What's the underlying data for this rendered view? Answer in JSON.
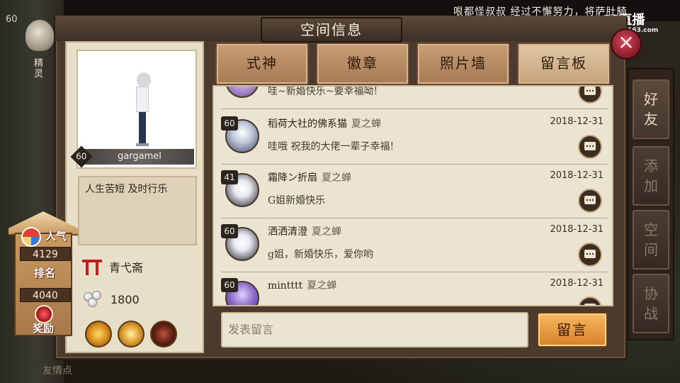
{
  "marquee": "哏都怪叔叔 经过不懈努力，将萨肚騎",
  "watermark": {
    "brand": "CC直播",
    "sub": "cc.163.com"
  },
  "background": {
    "level": "60",
    "side_label": "精灵",
    "bottom_text": "友情点"
  },
  "window": {
    "title": "空间信息",
    "close_symbol": "✕"
  },
  "profile": {
    "level": "60",
    "name": "gargamel",
    "motto": "人生苦短 及时行乐",
    "guild": "青弋斋",
    "coins": "1800"
  },
  "popularity": {
    "label_pop": "人气",
    "pop_value": "4129",
    "label_rank": "排名",
    "rank_value": "4040",
    "label_reward": "奖励"
  },
  "tabs": [
    {
      "label": "式神"
    },
    {
      "label": "徽章"
    },
    {
      "label": "照片墙"
    },
    {
      "label": "留言板"
    }
  ],
  "messages": [
    {
      "partial": true,
      "text": "哇~新婚快乐~要幸福呦!"
    },
    {
      "level": "60",
      "name": "稻荷大社的佛系猫",
      "tag": "夏之蝉",
      "date": "2018-12-31",
      "text": "哇哦 祝我的大佬一辈子幸福!"
    },
    {
      "level": "41",
      "name": "霜降ン折扇",
      "tag": "夏之蝉",
      "date": "2018-12-31",
      "text": "G姐新婚快乐"
    },
    {
      "level": "60",
      "name": "洒洒清澄",
      "tag": "夏之蝉",
      "date": "2018-12-31",
      "text": "g姐，新婚快乐，爱你哟"
    },
    {
      "level": "60",
      "name": "mintttt",
      "tag": "夏之蝉",
      "date": "2018-12-31",
      "text": ""
    }
  ],
  "compose": {
    "placeholder": "发表留言",
    "send_label": "留言"
  },
  "side_nav": [
    {
      "label": "好友",
      "active": true
    },
    {
      "label": "添加",
      "active": false
    },
    {
      "label": "空间",
      "active": false
    },
    {
      "label": "协战",
      "active": false
    }
  ]
}
